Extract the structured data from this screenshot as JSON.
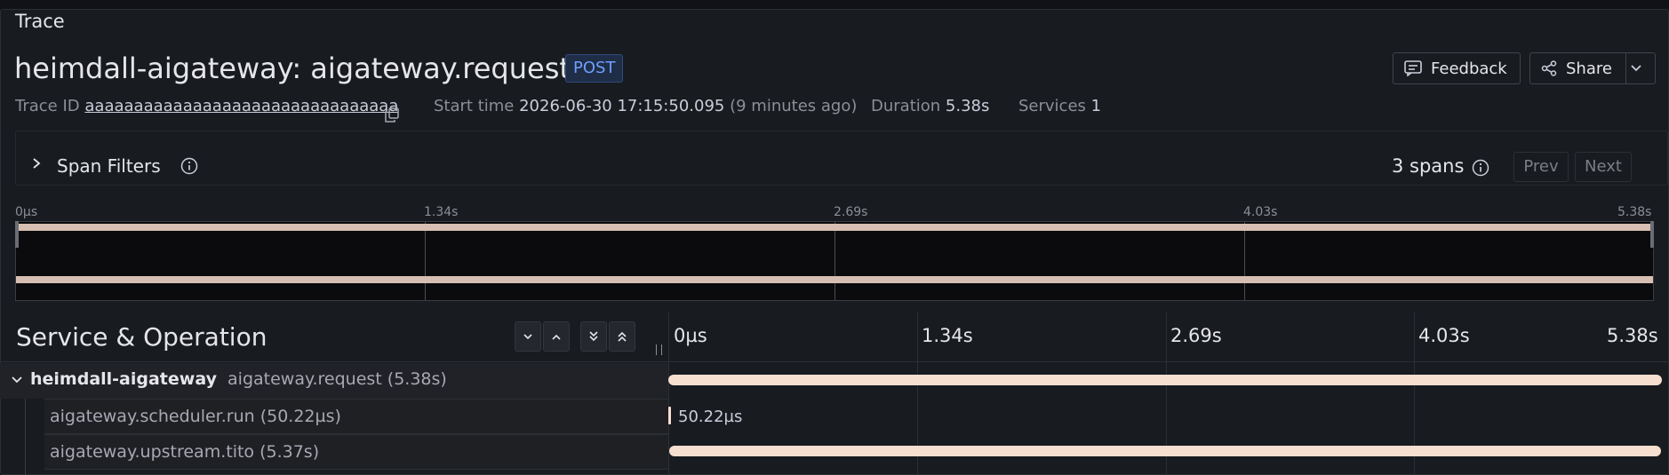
{
  "panel": {
    "title": "Trace"
  },
  "trace": {
    "title": "heimdall-aigateway: aigateway.request",
    "method_badge": "POST",
    "trace_id_label": "Trace ID",
    "trace_id": "aaaaaaaaaaaaaaaaaaaaaaaaaaaaaaaa",
    "start_time_label": "Start time",
    "start_time": "2026-06-30 17:15:50.095",
    "start_time_relative": "(9 minutes ago)",
    "duration_label": "Duration",
    "duration": "5.38s",
    "services_label": "Services",
    "services": "1"
  },
  "actions": {
    "feedback_label": "Feedback",
    "share_label": "Share"
  },
  "filters": {
    "title": "Span Filters",
    "span_count": "3 spans",
    "prev_label": "Prev",
    "next_label": "Next"
  },
  "timeline": {
    "ticks": [
      "0µs",
      "1.34s",
      "2.69s",
      "4.03s",
      "5.38s"
    ]
  },
  "table": {
    "header": "Service & Operation",
    "rows": [
      {
        "service": "heimdall-aigateway",
        "operation": "aigateway.request (5.38s)",
        "start_s": 0,
        "duration_s": 5.38
      },
      {
        "service": "",
        "operation": "aigateway.scheduler.run (50.22µs)",
        "start_s": 0,
        "duration_s": 5.022e-05,
        "duration_label": "50.22µs"
      },
      {
        "service": "",
        "operation": "aigateway.upstream.tito (5.37s)",
        "start_s": 0.005,
        "duration_s": 5.37
      }
    ]
  },
  "colors": {
    "span_bar": "#f7dfd0",
    "minimap_bar": "#d6bfb2",
    "badge": "#6e9fff"
  }
}
